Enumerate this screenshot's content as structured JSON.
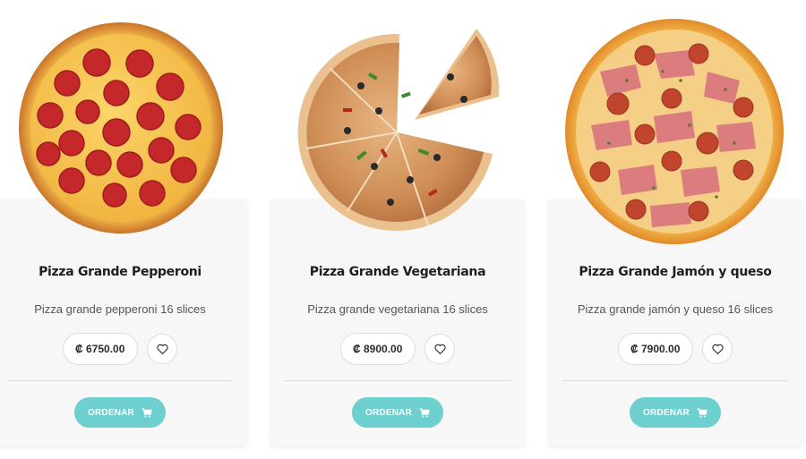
{
  "products": [
    {
      "title": "Pizza Grande Pepperoni",
      "description": "Pizza grande pepperoni 16 slices",
      "price": "₡ 6750.00",
      "order_label": "ORDENAR",
      "image_icon": "pepperoni-pizza-image"
    },
    {
      "title": "Pizza Grande Vegetariana",
      "description": "Pizza grande vegetariana 16 slices",
      "price": "₡ 8900.00",
      "order_label": "ORDENAR",
      "image_icon": "vegetarian-pizza-image"
    },
    {
      "title": "Pizza Grande Jamón y queso",
      "description": "Pizza grande jamón y queso 16 slices",
      "price": "₡ 7900.00",
      "order_label": "ORDENAR",
      "image_icon": "ham-cheese-pizza-image"
    }
  ],
  "colors": {
    "accent": "#6ecfcf",
    "card_background": "#f7f7f7",
    "title": "#1e1e1e",
    "description": "#555555"
  },
  "icons": {
    "favorite": "heart-icon",
    "cart": "cart-icon"
  }
}
